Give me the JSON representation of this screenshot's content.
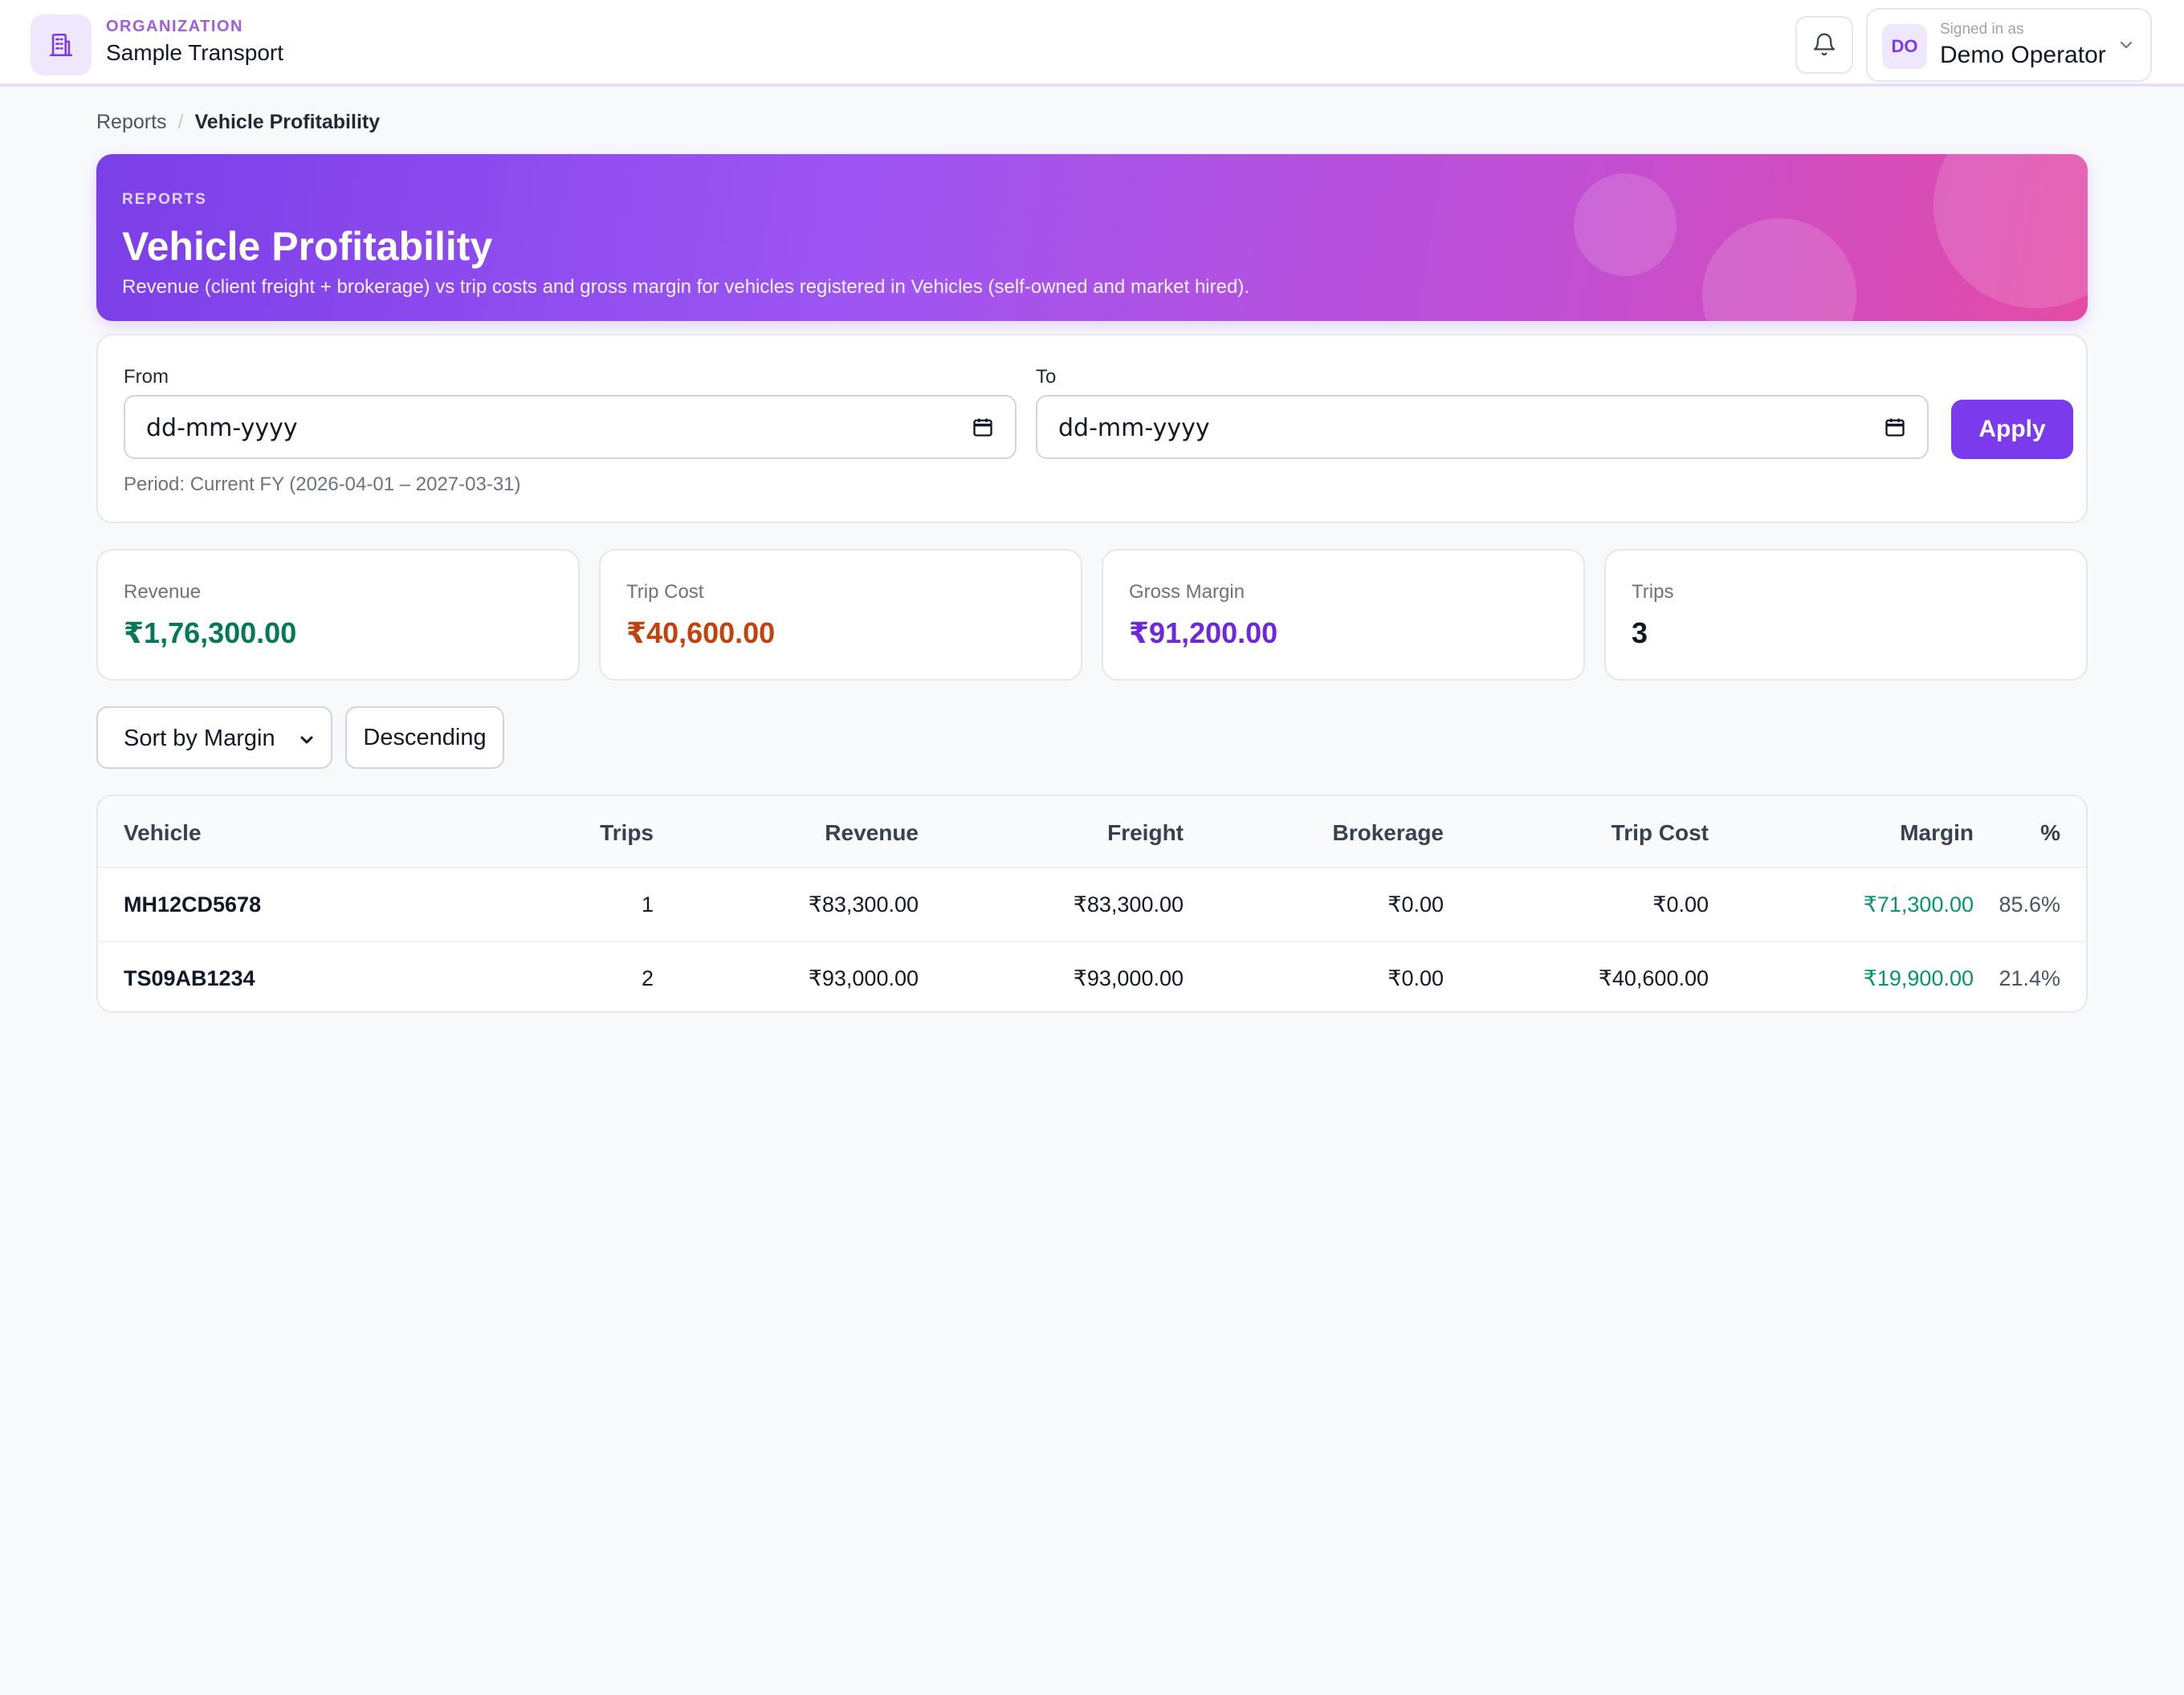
{
  "header": {
    "org_label": "ORGANIZATION",
    "org_name": "Sample Transport",
    "org_icon": "building-icon",
    "signed_in_label": "Signed in as",
    "user_initials": "DO",
    "user_name": "Demo Operator"
  },
  "breadcrumb": {
    "parent": "Reports",
    "separator": "/",
    "current": "Vehicle Profitability"
  },
  "hero": {
    "label": "REPORTS",
    "title": "Vehicle Profitability",
    "subtitle": "Revenue (client freight + brokerage) vs trip costs and gross margin for vehicles registered in Vehicles (self-owned and market hired)."
  },
  "filters": {
    "from_label": "From",
    "from_value": "dd-mm-yyyy",
    "to_label": "To",
    "to_value": "dd-mm-yyyy",
    "apply_label": "Apply",
    "period_text": "Period: Current FY (2026-04-01 – 2027-03-31)"
  },
  "stats": [
    {
      "label": "Revenue",
      "value": "₹1,76,300.00",
      "color": "#047857"
    },
    {
      "label": "Trip Cost",
      "value": "₹40,600.00",
      "color": "#c2410c"
    },
    {
      "label": "Gross Margin",
      "value": "₹91,200.00",
      "color": "#6d28d9"
    },
    {
      "label": "Trips",
      "value": "3",
      "color": "#111827"
    }
  ],
  "sort": {
    "selected": "Sort by Margin",
    "order_label": "Descending"
  },
  "table": {
    "columns": [
      "Vehicle",
      "Trips",
      "Revenue",
      "Freight",
      "Brokerage",
      "Trip Cost",
      "Margin",
      "%"
    ],
    "rows": [
      {
        "vehicle": "MH12CD5678",
        "trips": "1",
        "revenue": "₹83,300.00",
        "freight": "₹83,300.00",
        "brokerage": "₹0.00",
        "trip_cost": "₹0.00",
        "margin": "₹71,300.00",
        "pct": "85.6%"
      },
      {
        "vehicle": "TS09AB1234",
        "trips": "2",
        "revenue": "₹93,000.00",
        "freight": "₹93,000.00",
        "brokerage": "₹0.00",
        "trip_cost": "₹40,600.00",
        "margin": "₹19,900.00",
        "pct": "21.4%"
      }
    ]
  },
  "colors": {
    "accent": "#7c3aed",
    "margin_positive": "#059669"
  }
}
